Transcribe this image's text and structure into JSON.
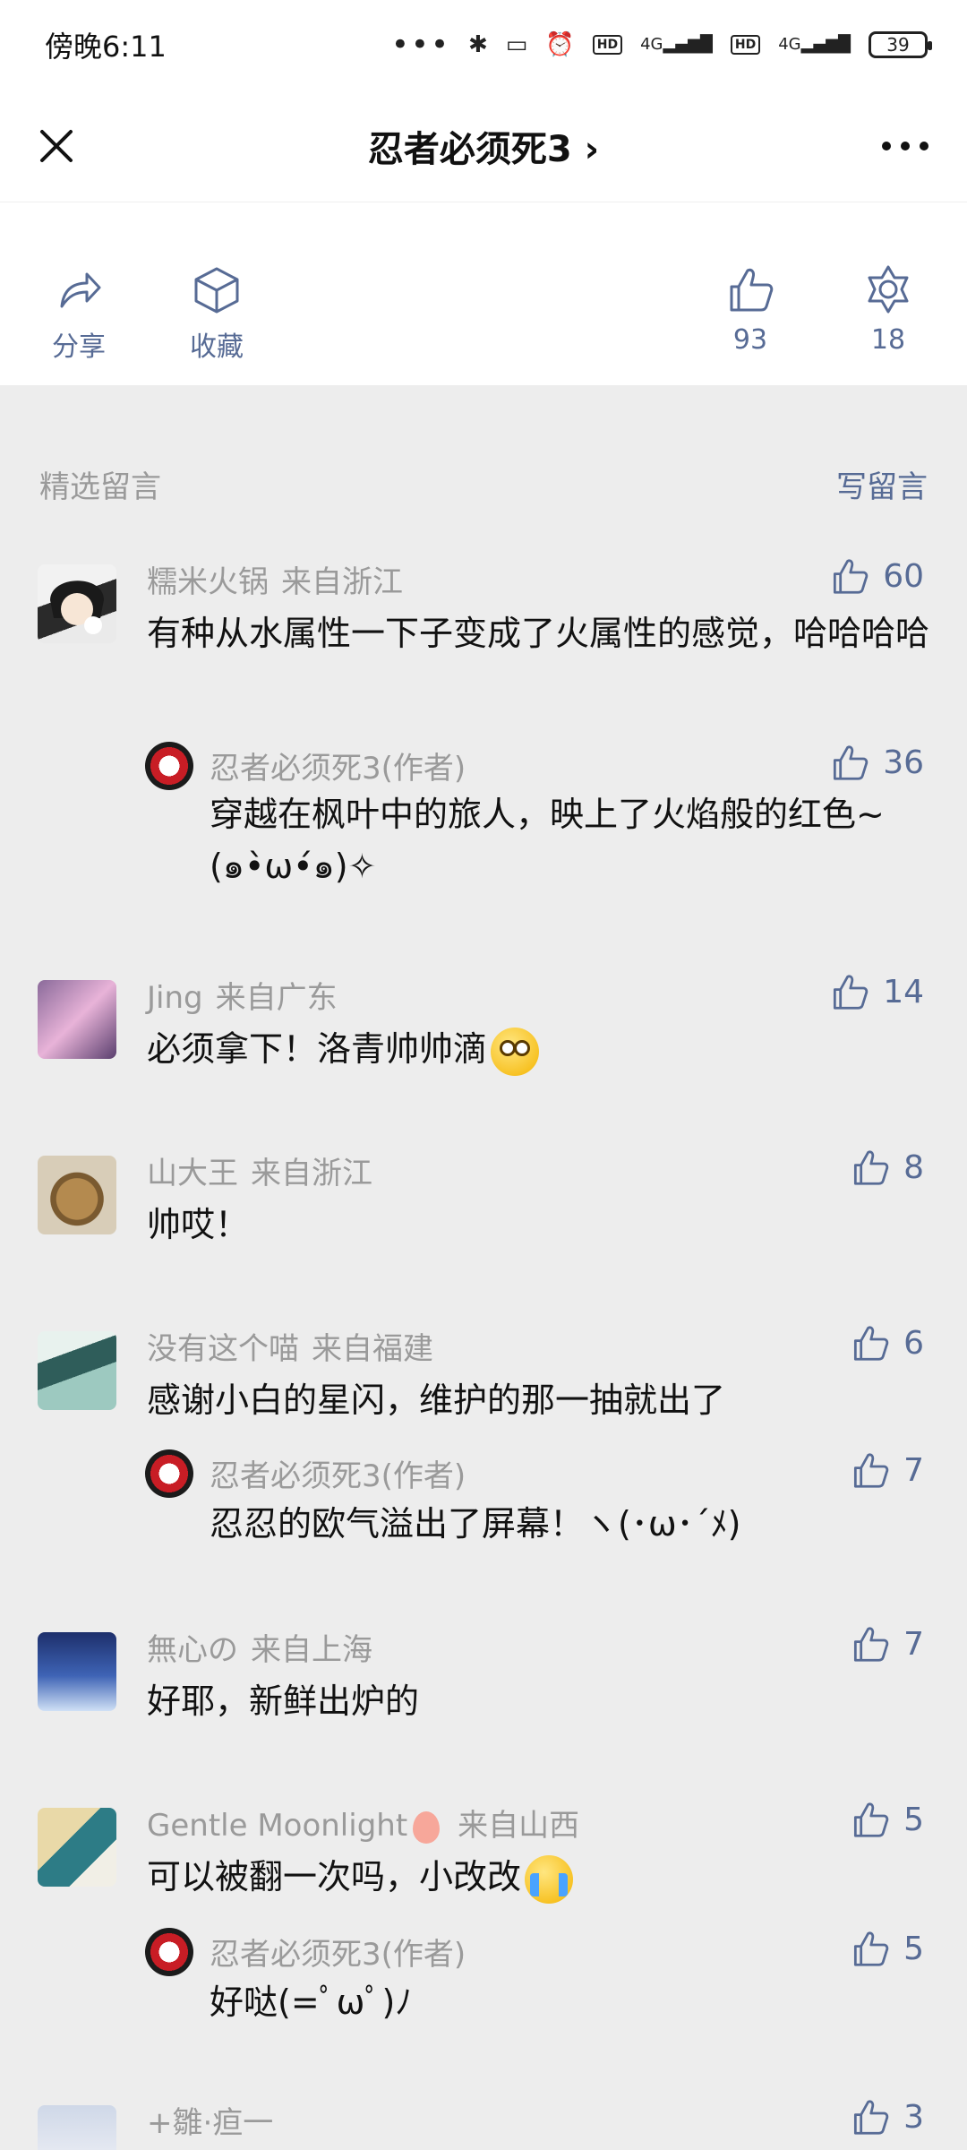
{
  "status_bar": {
    "time": "傍晚6:11",
    "signal_label": "4G",
    "battery": "39"
  },
  "nav": {
    "title": "忍者必须死3 ›"
  },
  "actions": {
    "share_label": "分享",
    "collect_label": "收藏",
    "like_count": "93",
    "wow_count": "18"
  },
  "comments_header": {
    "title": "精选留言",
    "write_label": "写留言"
  },
  "comments": [
    {
      "name": "糯米火锅",
      "location": "来自浙江",
      "text": "有种从水属性一下子变成了火属性的感觉，哈哈哈哈",
      "likes": "60",
      "reply": {
        "name": "忍者必须死3(作者)",
        "text": "穿越在枫叶中的旅人，映上了火焰般的红色~(๑•̀ω•́๑)✧",
        "likes": "36"
      }
    },
    {
      "name": "Jing",
      "location": "来自广东",
      "text": "必须拿下！洛青帅帅滴",
      "likes": "14"
    },
    {
      "name": "山大王",
      "location": "来自浙江",
      "text": "帅哎！",
      "likes": "8"
    },
    {
      "name": "没有这个喵",
      "location": "来自福建",
      "text": "感谢小白的星闪，维护的那一抽就出了",
      "likes": "6",
      "reply": {
        "name": "忍者必须死3(作者)",
        "text": "忍忍的欧气溢出了屏幕！ヽ(･ω･´ﾒ)",
        "likes": "7"
      }
    },
    {
      "name": "無心の",
      "location": "来自上海",
      "text": "好耶，新鲜出炉的",
      "likes": "7"
    },
    {
      "name": "Gentle Moonlight",
      "location": "来自山西",
      "text": "可以被翻一次吗，小改改",
      "likes": "5",
      "reply": {
        "name": "忍者必须死3(作者)",
        "text": "好哒(=ﾟωﾟ)ﾉ",
        "likes": "5"
      }
    },
    {
      "name": "+雛·疸一",
      "location": "",
      "text": "",
      "likes": "3"
    }
  ],
  "colors": {
    "link": "#576b95",
    "muted": "#9a9a9a",
    "page_bg": "#ededed"
  }
}
